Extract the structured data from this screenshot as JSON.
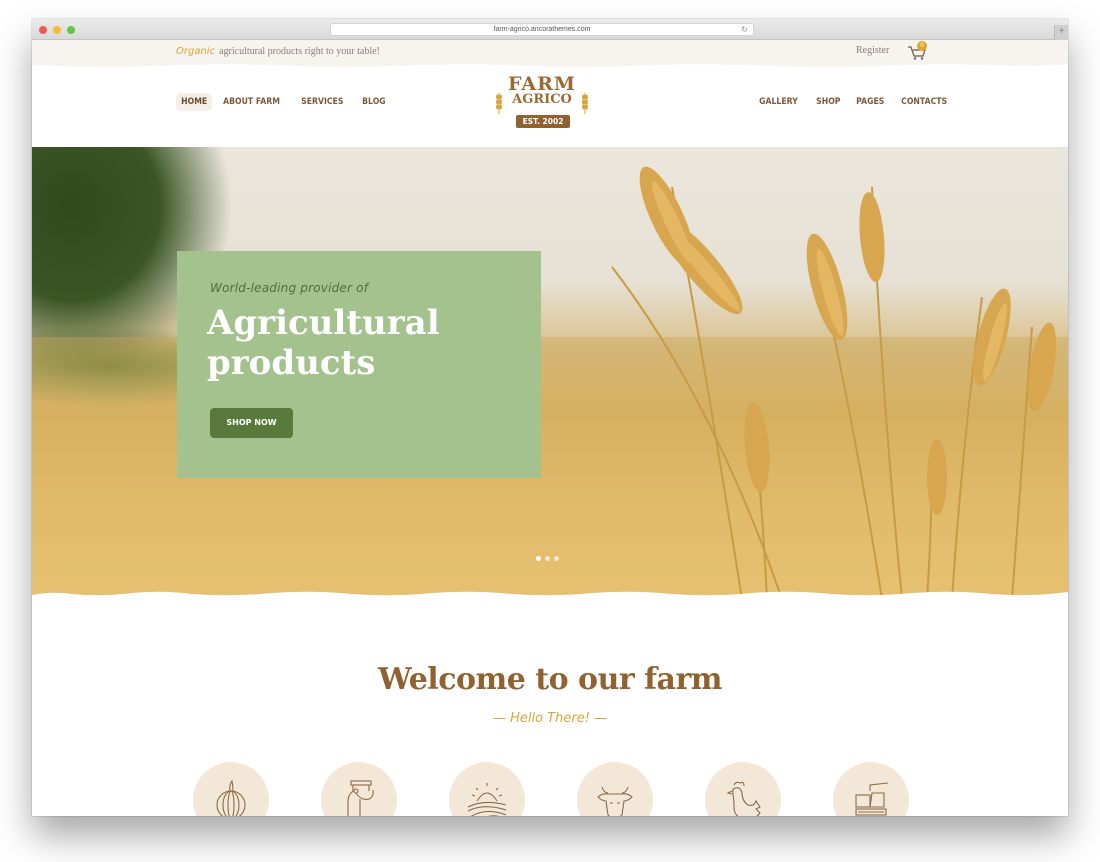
{
  "browser": {
    "url": "farm-agrico.ancorathemes.com",
    "traffic_lights": [
      "#ee5b52",
      "#f4bd36",
      "#5fc93f"
    ]
  },
  "topbar": {
    "organic": "Organic",
    "tagline": "agricultural products right to your table!",
    "register": "Register",
    "cart_count": "0"
  },
  "nav": {
    "left": [
      "HOME",
      "ABOUT FARM",
      "SERVICES",
      "BLOG"
    ],
    "right": [
      "GALLERY",
      "SHOP",
      "PAGES",
      "CONTACTS"
    ],
    "active": "HOME"
  },
  "logo": {
    "line1": "FARM",
    "line2": "AGRICO",
    "est": "EST. 2002"
  },
  "hero": {
    "kicker": "World-leading provider of",
    "title_line1": "Agricultural",
    "title_line2": "products",
    "button": "SHOP NOW",
    "slides": 3,
    "active_slide": 1
  },
  "welcome": {
    "title": "Welcome to our farm",
    "subtitle": "— Hello There! —",
    "features": [
      {
        "icon": "pumpkin-icon"
      },
      {
        "icon": "milk-can-icon"
      },
      {
        "icon": "sunrise-field-icon"
      },
      {
        "icon": "cow-icon"
      },
      {
        "icon": "rooster-icon"
      },
      {
        "icon": "harvester-icon"
      }
    ]
  },
  "colors": {
    "brand_brown": "#8f6230",
    "accent_gold": "#d9a43a",
    "hero_card_green": "#a3c28d",
    "button_green": "#587a3c",
    "feature_circle": "#f3e8d8"
  }
}
